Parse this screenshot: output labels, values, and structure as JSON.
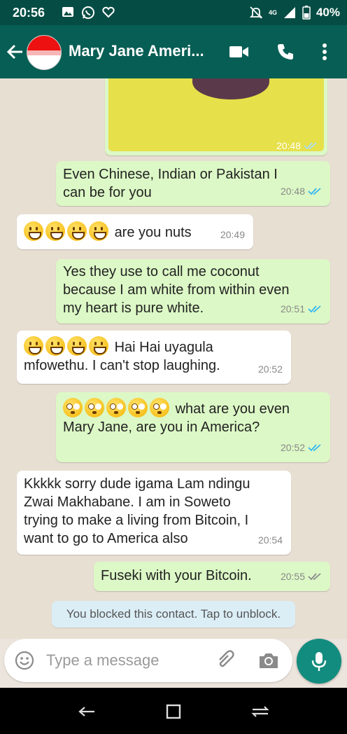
{
  "status": {
    "time": "20:56",
    "network": "4G",
    "battery": "40%"
  },
  "header": {
    "contact_name": "Mary Jane Ameri...",
    "icons": [
      "back-arrow-icon",
      "video-call-icon",
      "phone-icon",
      "more-options-icon"
    ]
  },
  "photo_message": {
    "time": "20:48",
    "ticks": "read"
  },
  "messages": [
    {
      "direction": "out",
      "text": "Even Chinese, Indian or Pakistan I\ncan be for you",
      "time": "20:48",
      "ticks": "read"
    },
    {
      "direction": "in",
      "emoji_prefix": [
        "grinning-face",
        "grinning-face",
        "grinning-face",
        "grinning-face"
      ],
      "text": "are you nuts",
      "time": "20:49"
    },
    {
      "direction": "out",
      "text": "Yes they use to call me coconut\nbecause I am white from within even\nmy heart is pure white.",
      "time": "20:51",
      "ticks": "read"
    },
    {
      "direction": "in",
      "emoji_prefix": [
        "grinning-face",
        "grinning-face",
        "grinning-face",
        "grinning-face"
      ],
      "text": "Hai Hai uyagula\nmfowethu. I can't stop laughing.",
      "time": "20:52"
    },
    {
      "direction": "out",
      "emoji_prefix": [
        "flushed-face",
        "flushed-face",
        "flushed-face",
        "flushed-face",
        "flushed-face"
      ],
      "text": "what are you even\nMary Jane, are you in America?",
      "time": "20:52",
      "ticks": "read"
    },
    {
      "direction": "in",
      "text": "Kkkkk sorry dude igama Lam ndingu\nZwai Makhabane. I am in Soweto\ntrying to make a living from Bitcoin, I\nwant to go to America also",
      "time": "20:54"
    },
    {
      "direction": "out",
      "text": "Fuseki with your Bitcoin.",
      "time": "20:55",
      "ticks": "delivered"
    }
  ],
  "system_message": "You blocked this contact. Tap to unblock.",
  "composer": {
    "placeholder": "Type a message",
    "icons": [
      "emoji-icon",
      "attach-icon",
      "camera-icon",
      "mic-icon"
    ]
  },
  "colors": {
    "header": "#075e54",
    "outgoing_bubble": "#dcf8c6",
    "incoming_bubble": "#ffffff",
    "read_tick": "#34b7f1",
    "mic_button": "#128c7e"
  }
}
